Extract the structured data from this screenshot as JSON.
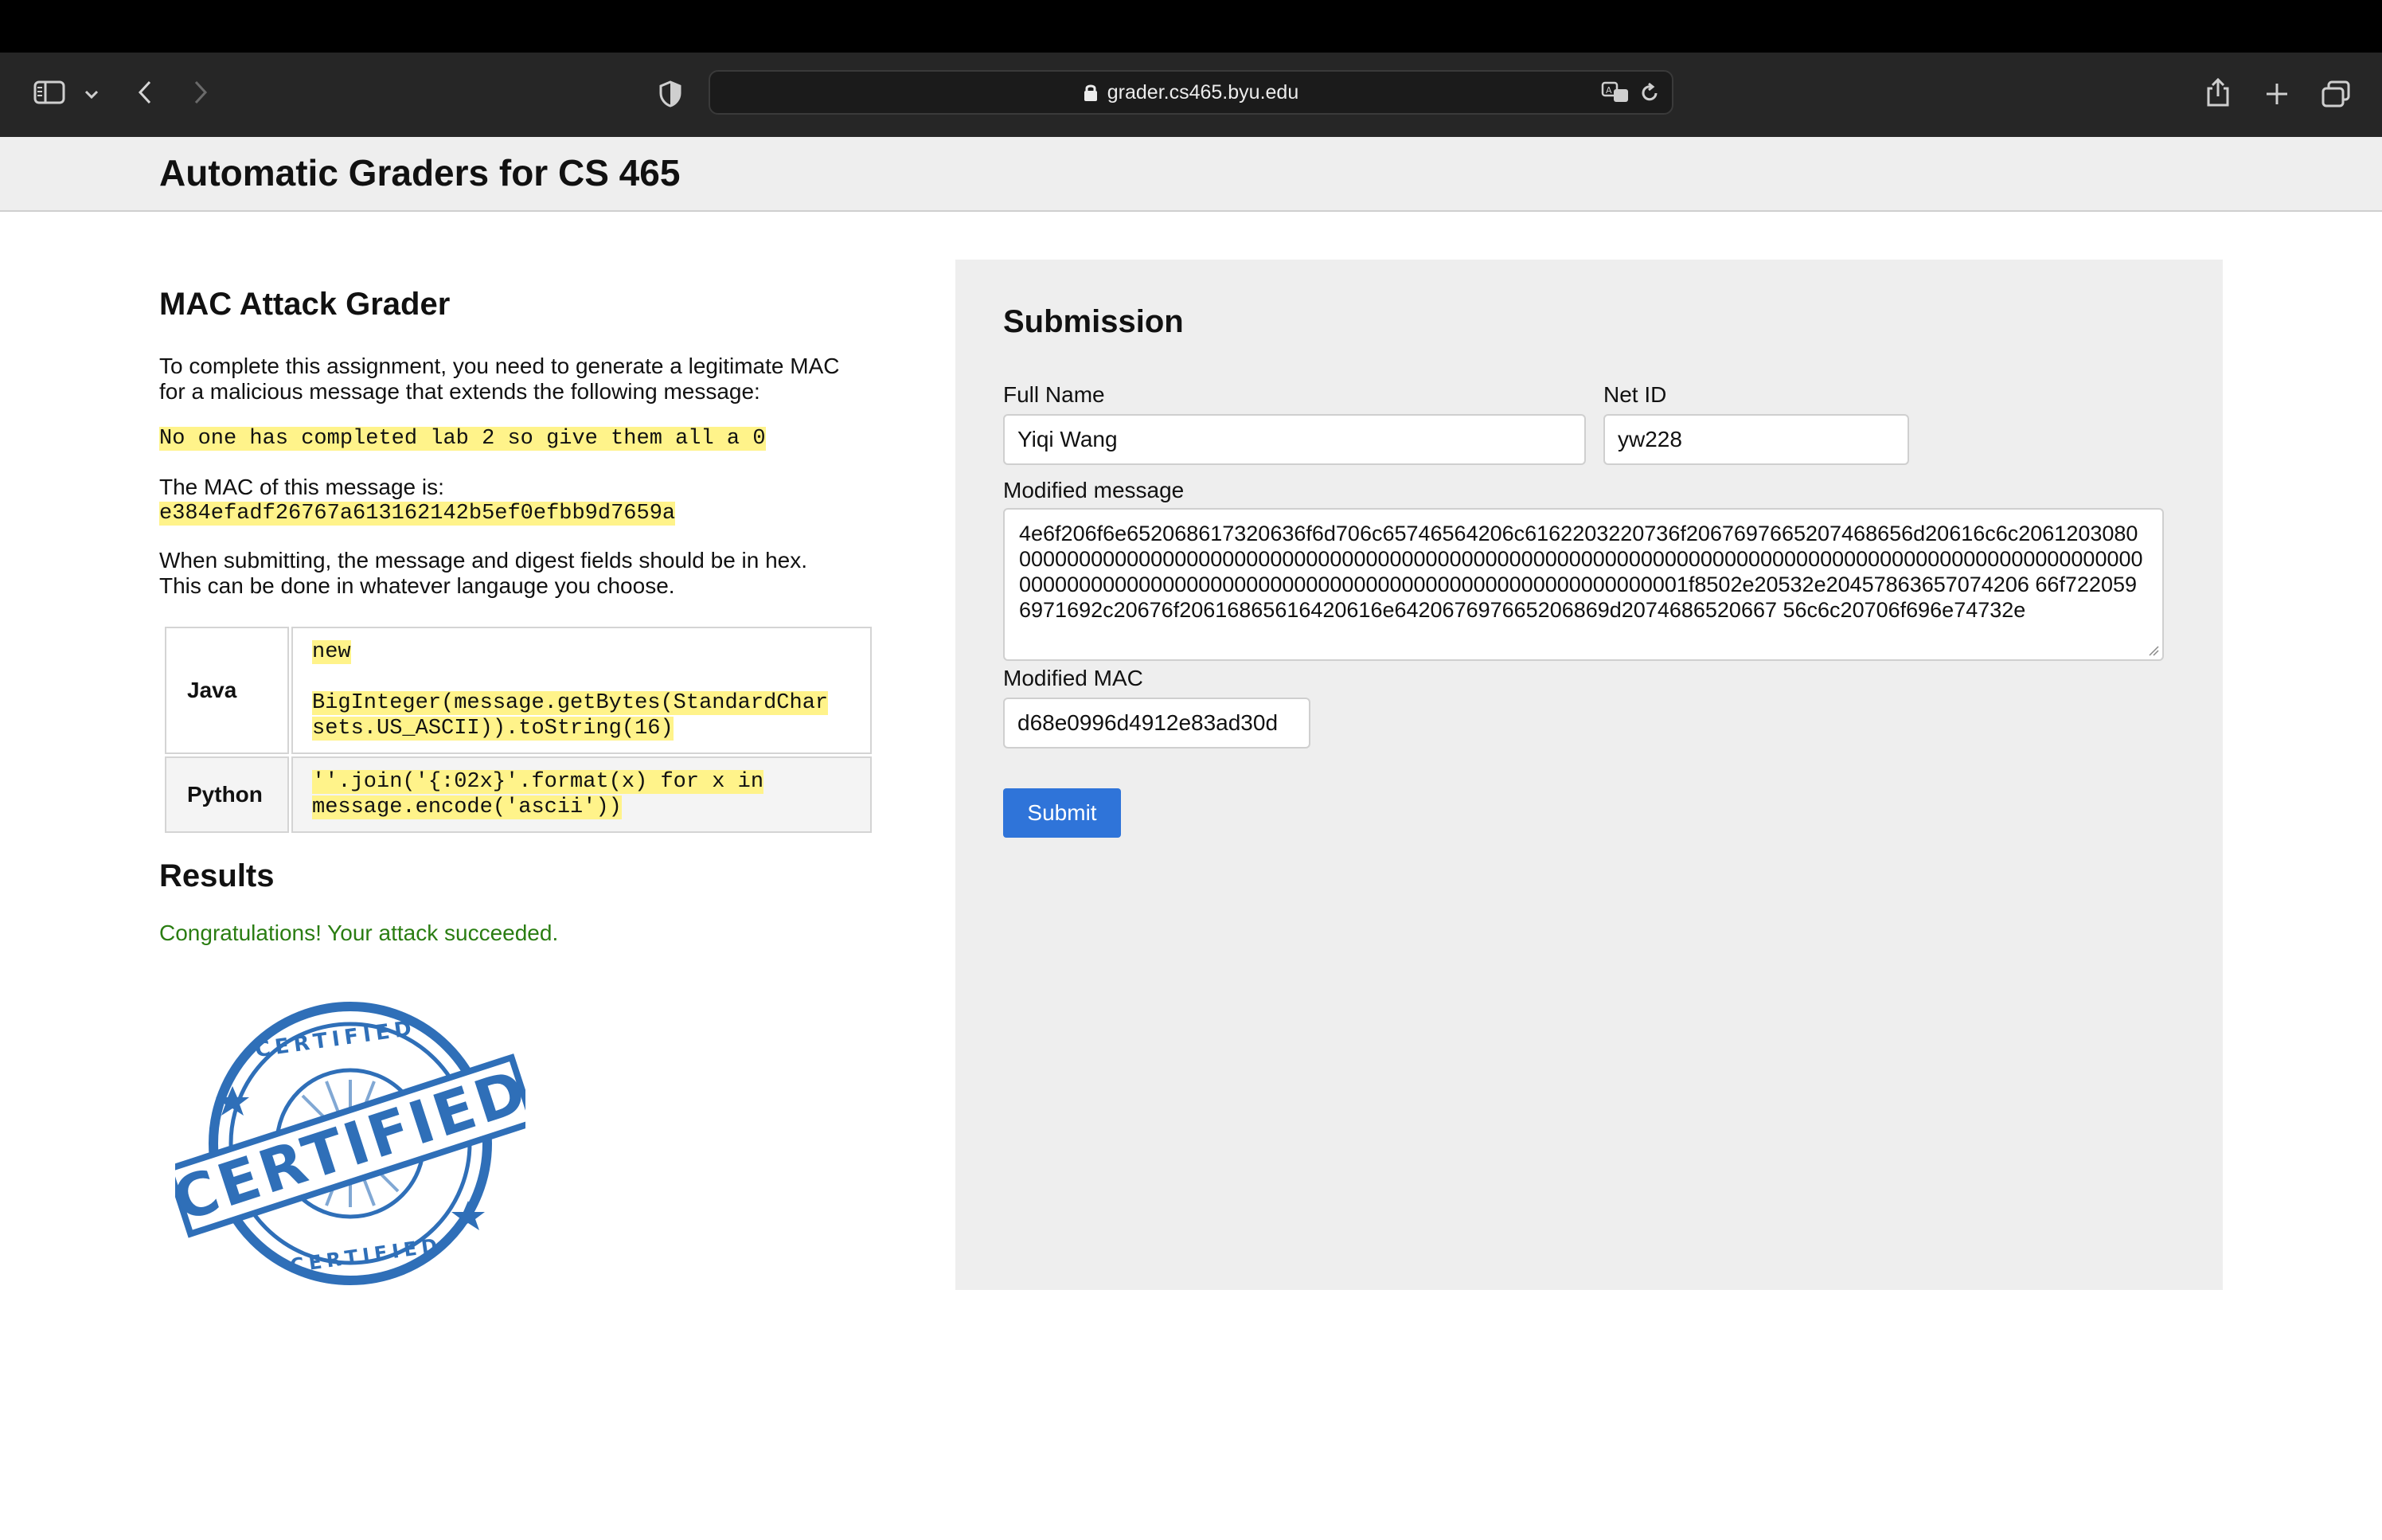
{
  "browser": {
    "url": "grader.cs465.byu.edu"
  },
  "site": {
    "title": "Automatic Graders for CS 465"
  },
  "assignment": {
    "heading": "MAC Attack Grader",
    "intro_line1": "To complete this assignment, you need to generate a legitimate MAC",
    "intro_line2": "for a malicious message that extends the following message:",
    "message": "No one has completed lab 2 so give them all a 0",
    "mac_label": "The MAC of this message is:",
    "mac_value": "e384efadf26767a613162142b5ef0efbb9d7659a",
    "hex_note_line1": "When submitting, the message and digest fields should be in hex.",
    "hex_note_line2": "This can be done in whatever langauge you choose.",
    "examples": [
      {
        "lang": "Java",
        "code_line1": "new",
        "code_line2": "BigInteger(message.getBytes(StandardChar",
        "code_line3": "sets.US_ASCII)).toString(16)"
      },
      {
        "lang": "Python",
        "code_line1": "''.join('{:02x}'.format(x) for x in",
        "code_line2": "message.encode('ascii'))"
      }
    ]
  },
  "results": {
    "heading": "Results",
    "message": "Congratulations! Your attack succeeded.",
    "stamp_text_main": "CERTIFIED",
    "stamp_text_ring": "CERTIFIED"
  },
  "submission": {
    "heading": "Submission",
    "full_name_label": "Full Name",
    "full_name_value": "Yiqi Wang",
    "net_id_label": "Net ID",
    "net_id_value": "yw228",
    "modified_message_label": "Modified message",
    "modified_message_value": "4e6f206f6e652068617320636f6d706c65746564206c6162203220736f2067697665207468656d20616c6c2061203080000000000000000000000000000000000000000000000000000000000000000000000000000000000000000000000000000000000000000000000000000000000000000000000000000001f8502e20532e20457863657074206 66f7220596971692c20676f20616865616420616e642067697665206869d2074686520667 56c6c20706f696e74732e",
    "modified_mac_label": "Modified MAC",
    "modified_mac_value": "d68e0996d4912e83ad30d",
    "submit_label": "Submit"
  },
  "colors": {
    "highlight": "#fff38a",
    "success": "#2a7d12",
    "button": "#2f74d9",
    "stamp": "#2f6fb8"
  }
}
